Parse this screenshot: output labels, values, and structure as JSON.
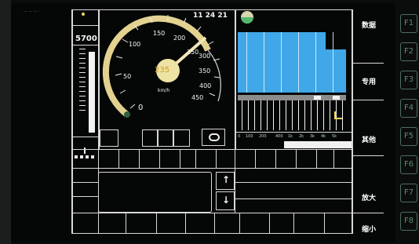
{
  "header": {
    "left_status": "··· ··· ··· ·",
    "time": "11 24 21"
  },
  "left_panel": {
    "value": "5700"
  },
  "speedometer": {
    "current_speed": 235,
    "unit": "km/h",
    "target_speed": 235,
    "max": 450,
    "scale": [
      "0",
      "50",
      "100",
      "150",
      "200",
      "250",
      "300",
      "350",
      "400",
      "450"
    ]
  },
  "trackmap": {
    "ticks": [
      "0",
      "100",
      "200",
      "400",
      "1k",
      "2k",
      "3k",
      "4k",
      "5k"
    ]
  },
  "arrows": {
    "up": "↑",
    "down": "↓"
  },
  "side_menu": [
    {
      "label": "数据"
    },
    {
      "label": "专用"
    },
    {
      "label": "其他"
    },
    {
      "label": "放大"
    },
    {
      "label": "缩小"
    }
  ],
  "function_keys": [
    "F1",
    "F2",
    "F3",
    "F4",
    "F5",
    "F6",
    "F7",
    "F8"
  ],
  "colors": {
    "accent": "#e3d28f",
    "bars": "#40a8e8",
    "line": "#d8d8d8"
  }
}
